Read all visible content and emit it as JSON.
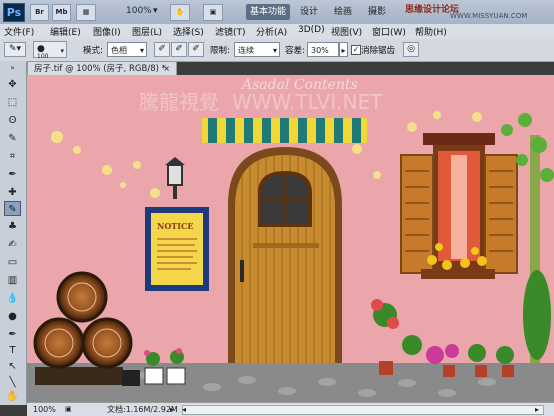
{
  "app": {
    "logo": "Ps",
    "buttons": [
      "Br",
      "Mb"
    ],
    "zoom": "100%",
    "workspace_tabs": [
      "基本功能",
      "设计",
      "绘画",
      "摄影"
    ],
    "watermark_site": "WWW.MISSYUAN.COM",
    "watermark_forum": "思缘设计论坛"
  },
  "menu": [
    "文件(F)",
    "编辑(E)",
    "图像(I)",
    "图层(L)",
    "选择(S)",
    "滤镜(T)",
    "分析(A)",
    "3D(D)",
    "视图(V)",
    "窗口(W)",
    "帮助(H)"
  ],
  "options": {
    "brush_size": "100",
    "mode_label": "模式:",
    "mode_value": "色相",
    "limit_label": "限制:",
    "limit_value": "连续",
    "tolerance_label": "容差:",
    "tolerance_value": "30%",
    "antialias_label": "消除锯齿"
  },
  "document": {
    "tab_title": "房子.tif @ 100% (房子, RGB/8) *",
    "close_label": "×"
  },
  "canvas": {
    "watermark_top": "Asadal Contents",
    "watermark_cn": "騰龍視覺",
    "watermark_url": "WWW.TLVI.NET",
    "notice_title": "NOTICE"
  },
  "status": {
    "zoom": "100%",
    "doc_label": "文档:1.16M/2.92M"
  },
  "colors": {
    "wall": "#eaa6ab",
    "door": "#c98b2f",
    "awning_yellow": "#f2d836",
    "awning_teal": "#1f7a78",
    "ground": "#8a8a8a"
  }
}
